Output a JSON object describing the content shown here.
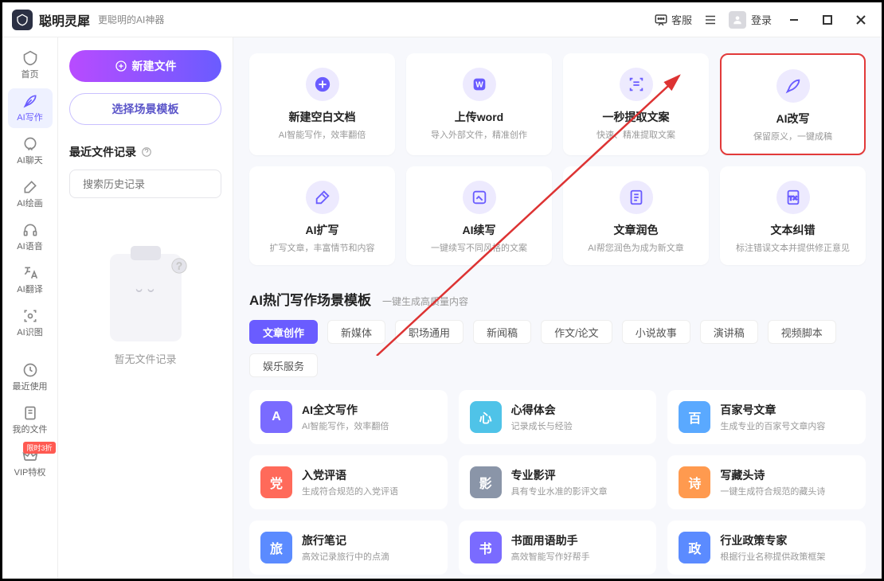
{
  "header": {
    "app_name": "聪明灵犀",
    "tagline": "更聪明的AI神器",
    "customer_service": "客服",
    "login": "登录"
  },
  "sidebar": {
    "items": [
      {
        "label": "首页"
      },
      {
        "label": "AI写作"
      },
      {
        "label": "AI聊天"
      },
      {
        "label": "AI绘画"
      },
      {
        "label": "AI语音"
      },
      {
        "label": "AI翻译"
      },
      {
        "label": "AI识图"
      },
      {
        "label": "最近使用"
      },
      {
        "label": "我的文件"
      },
      {
        "label": "VIP特权",
        "badge": "限时3折"
      }
    ]
  },
  "panel": {
    "new_file": "新建文件",
    "choose_template": "选择场景模板",
    "recent_title": "最近文件记录",
    "search_placeholder": "搜索历史记录",
    "empty_text": "暂无文件记录"
  },
  "feature_cards": [
    {
      "title": "新建空白文档",
      "desc": "AI智能写作，效率翻倍"
    },
    {
      "title": "上传word",
      "desc": "导入外部文件，精准创作"
    },
    {
      "title": "一秒提取文案",
      "desc": "快速、精准提取文案"
    },
    {
      "title": "AI改写",
      "desc": "保留原义，一键成稿",
      "highlighted": true
    },
    {
      "title": "AI扩写",
      "desc": "扩写文章，丰富情节和内容"
    },
    {
      "title": "AI续写",
      "desc": "一键续写不同风格的文案"
    },
    {
      "title": "文章润色",
      "desc": "AI帮您润色为成为新文章"
    },
    {
      "title": "文本纠错",
      "desc": "标注错误文本并提供修正意见"
    }
  ],
  "section": {
    "title": "AI热门写作场景模板",
    "subtitle": "一键生成高质量内容"
  },
  "tabs": [
    "文章创作",
    "新媒体",
    "职场通用",
    "新闻稿",
    "作文/论文",
    "小说故事",
    "演讲稿",
    "视频脚本",
    "娱乐服务"
  ],
  "active_tab": 0,
  "templates": [
    {
      "title": "AI全文写作",
      "desc": "AI智能写作，效率翻倍",
      "color": "#7a6bff",
      "glyph": "A"
    },
    {
      "title": "心得体会",
      "desc": "记录成长与经验",
      "color": "#4fc3e8",
      "glyph": "心"
    },
    {
      "title": "百家号文章",
      "desc": "生成专业的百家号文章内容",
      "color": "#5aa9ff",
      "glyph": "百"
    },
    {
      "title": "入党评语",
      "desc": "生成符合规范的入党评语",
      "color": "#ff6a5a",
      "glyph": "党"
    },
    {
      "title": "专业影评",
      "desc": "具有专业水准的影评文章",
      "color": "#8a95a8",
      "glyph": "影"
    },
    {
      "title": "写藏头诗",
      "desc": "一键生成符合规范的藏头诗",
      "color": "#ff9a4f",
      "glyph": "诗"
    },
    {
      "title": "旅行笔记",
      "desc": "高效记录旅行中的点滴",
      "color": "#5b8bff",
      "glyph": "旅"
    },
    {
      "title": "书面用语助手",
      "desc": "高效智能写作好帮手",
      "color": "#7a6bff",
      "glyph": "书"
    },
    {
      "title": "行业政策专家",
      "desc": "根据行业名称提供政策框架",
      "color": "#5b8bff",
      "glyph": "政"
    }
  ]
}
